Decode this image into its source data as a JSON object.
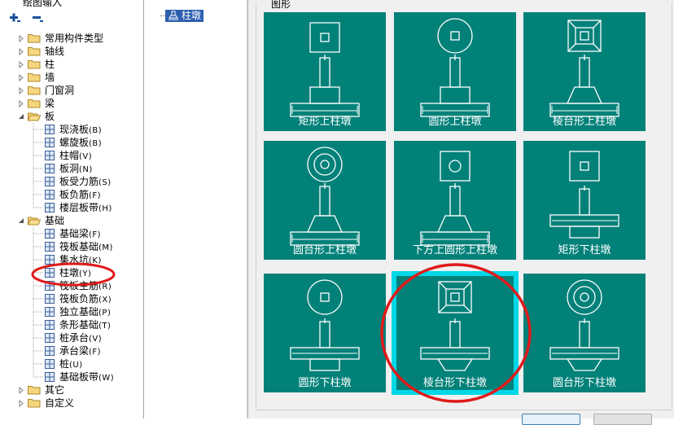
{
  "left_panel": {
    "title": "绘图输入",
    "toolbar": {
      "add": "add-icon",
      "remove": "remove-icon"
    },
    "tree": [
      {
        "label": "常用构件类型",
        "type": "folder",
        "expanded": false
      },
      {
        "label": "轴线",
        "type": "folder",
        "expanded": false
      },
      {
        "label": "柱",
        "type": "folder",
        "expanded": false
      },
      {
        "label": "墙",
        "type": "folder",
        "expanded": false
      },
      {
        "label": "门窗洞",
        "type": "folder",
        "expanded": false
      },
      {
        "label": "梁",
        "type": "folder",
        "expanded": false
      },
      {
        "label": "板",
        "type": "folder",
        "expanded": true
      },
      {
        "label": "现浇板",
        "shortcut": "(B)",
        "type": "child"
      },
      {
        "label": "螺旋板",
        "shortcut": "(B)",
        "type": "child"
      },
      {
        "label": "柱帽",
        "shortcut": "(V)",
        "type": "child"
      },
      {
        "label": "板洞",
        "shortcut": "(N)",
        "type": "child"
      },
      {
        "label": "板受力筋",
        "shortcut": "(S)",
        "type": "child"
      },
      {
        "label": "板负筋",
        "shortcut": "(F)",
        "type": "child"
      },
      {
        "label": "楼层板带",
        "shortcut": "(H)",
        "type": "child"
      },
      {
        "label": "基础",
        "type": "folder",
        "expanded": true
      },
      {
        "label": "基础梁",
        "shortcut": "(F)",
        "type": "child"
      },
      {
        "label": "筏板基础",
        "shortcut": "(M)",
        "type": "child"
      },
      {
        "label": "集水坑",
        "shortcut": "(K)",
        "type": "child"
      },
      {
        "label": "柱墩",
        "shortcut": "(Y)",
        "type": "child",
        "highlight": true
      },
      {
        "label": "筏板主筋",
        "shortcut": "(R)",
        "type": "child"
      },
      {
        "label": "筏板负筋",
        "shortcut": "(X)",
        "type": "child"
      },
      {
        "label": "独立基础",
        "shortcut": "(P)",
        "type": "child"
      },
      {
        "label": "条形基础",
        "shortcut": "(T)",
        "type": "child"
      },
      {
        "label": "桩承台",
        "shortcut": "(V)",
        "type": "child"
      },
      {
        "label": "承台梁",
        "shortcut": "(F)",
        "type": "child"
      },
      {
        "label": "桩",
        "shortcut": "(U)",
        "type": "child"
      },
      {
        "label": "基础板带",
        "shortcut": "(W)",
        "type": "child"
      },
      {
        "label": "其它",
        "type": "folder",
        "expanded": false
      },
      {
        "label": "自定义",
        "type": "folder",
        "expanded": false
      }
    ]
  },
  "middle_panel": {
    "selected_item": "柱墩"
  },
  "right_panel": {
    "group_title": "图形",
    "tiles": [
      {
        "label": "矩形上柱墩",
        "shape": "rect-up",
        "selected": false
      },
      {
        "label": "圆形上柱墩",
        "shape": "round-up",
        "selected": false
      },
      {
        "label": "棱台形上柱墩",
        "shape": "frustum-up",
        "selected": false
      },
      {
        "label": "圆台形上柱墩",
        "shape": "cone-up",
        "selected": false
      },
      {
        "label": "下方上圆形上柱墩",
        "shape": "square-round-up",
        "selected": false
      },
      {
        "label": "矩形下柱墩",
        "shape": "rect-down",
        "selected": false
      },
      {
        "label": "圆形下柱墩",
        "shape": "round-down",
        "selected": false
      },
      {
        "label": "棱台形下柱墩",
        "shape": "frustum-down",
        "selected": true
      },
      {
        "label": "圆台形下柱墩",
        "shape": "cone-down",
        "selected": false
      }
    ]
  },
  "colors": {
    "tile_bg": "#028179",
    "line": "#ffffff",
    "selected": "#00d8e8",
    "annotation": "#e01a1a",
    "tree_select": "#2d5fb0"
  }
}
